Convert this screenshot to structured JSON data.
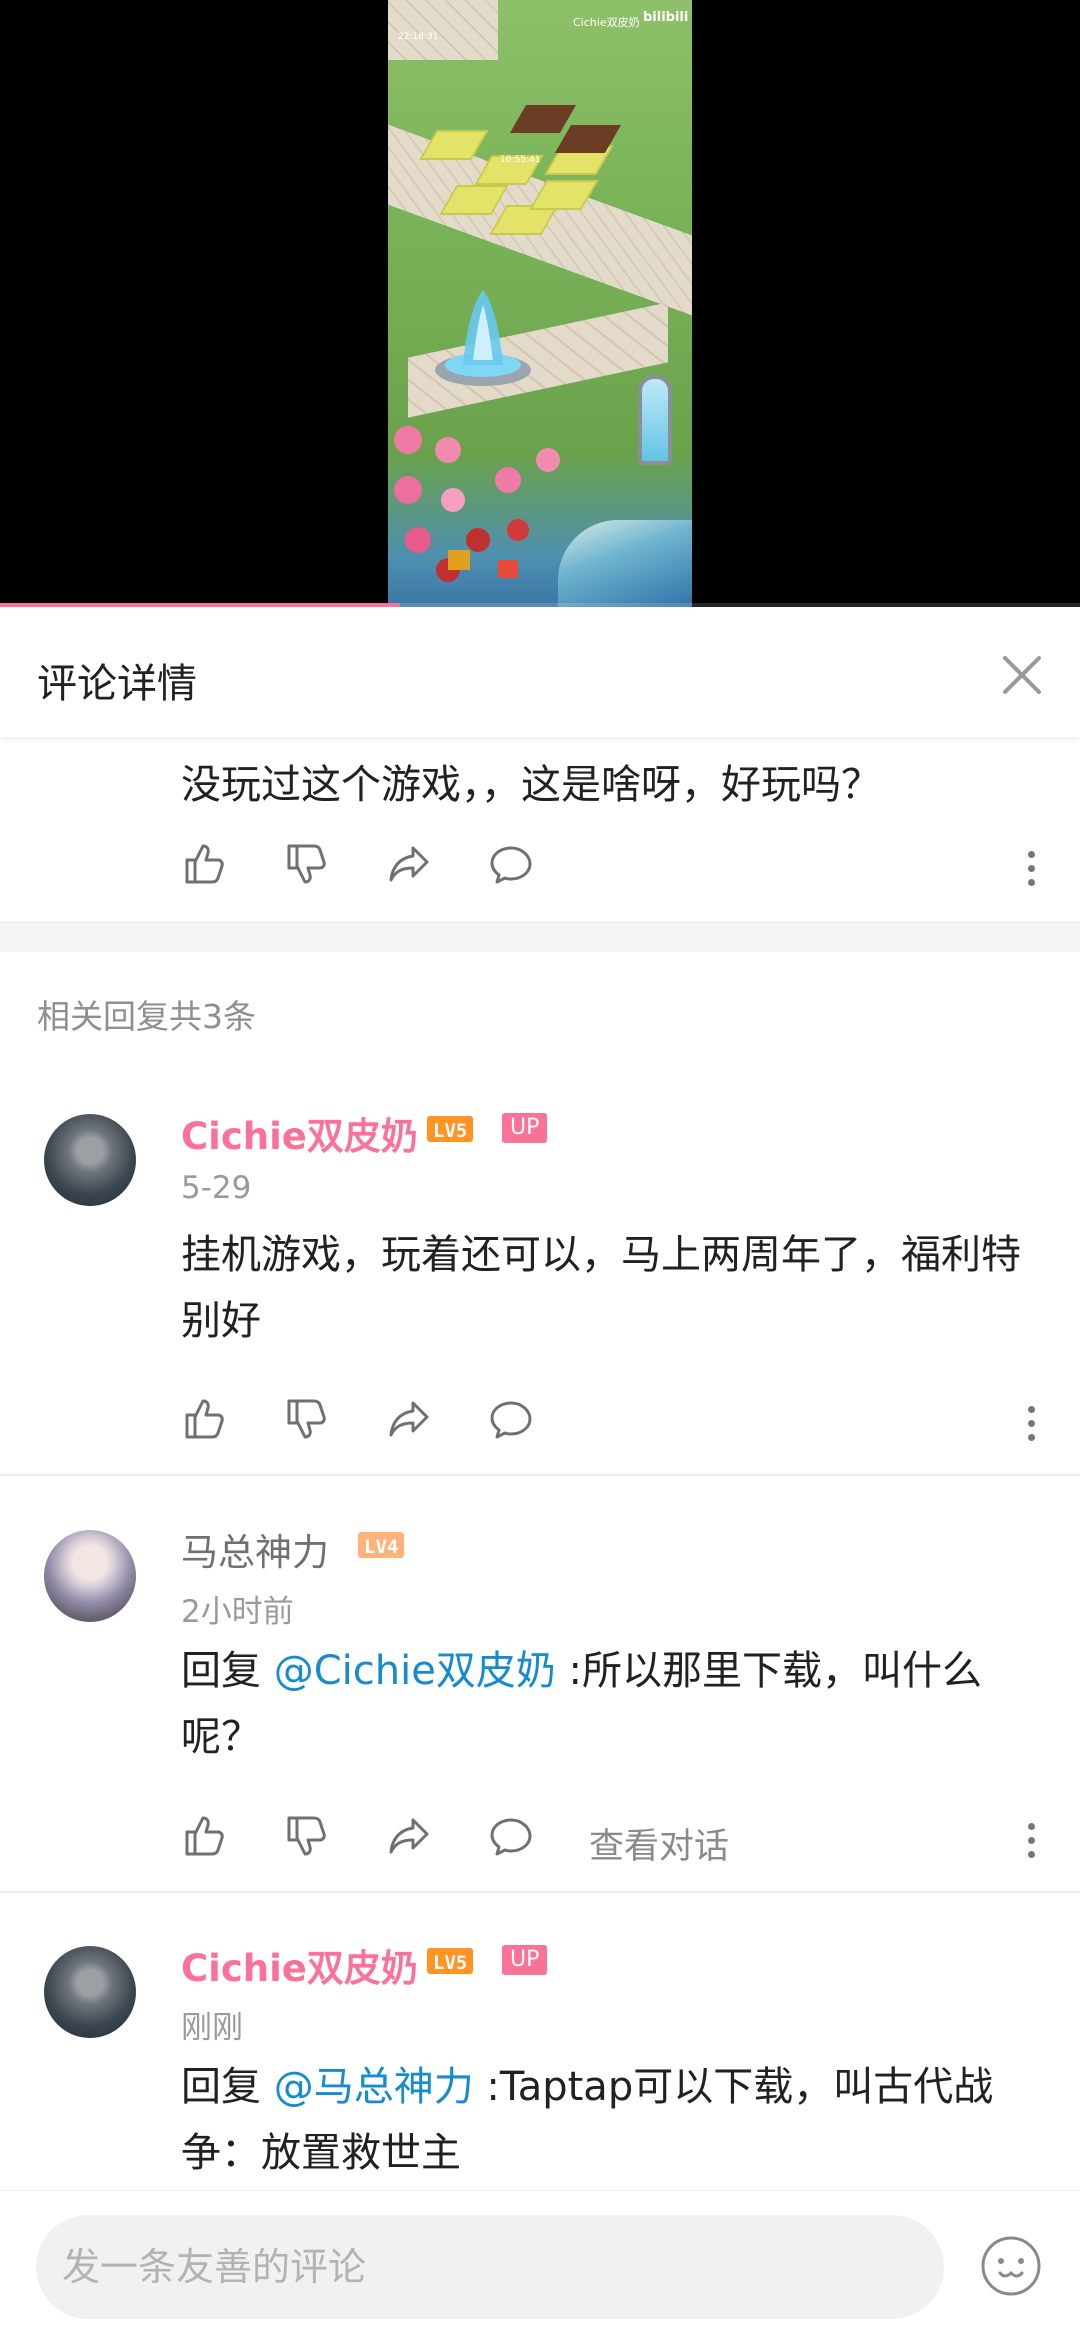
{
  "video": {
    "watermark_user": "Cichie双皮奶",
    "watermark_logo": "bilibili",
    "watermark_time": "22:18:31",
    "overlay_time": "10:55:41",
    "progress_fraction": 0.37
  },
  "panel": {
    "title": "评论详情"
  },
  "root_comment": {
    "text": "没玩过这个游戏，，这是啥呀，好玩吗？"
  },
  "reply_summary": "相关回复共3条",
  "replies": [
    {
      "user": "Cichie双皮奶",
      "level": "LV5",
      "badge": "UP",
      "time": "5-29",
      "prefix": "",
      "mention": "",
      "text": "挂机游戏，玩着还可以，马上两周年了，福利特别好"
    },
    {
      "user": "马总神力",
      "level": "LV4",
      "badge": "",
      "time": "2小时前",
      "prefix": "回复 ",
      "mention": "@Cichie双皮奶",
      "text": " :所以那里下载，叫什么呢？",
      "see_conversation": "查看对话"
    },
    {
      "user": "Cichie双皮奶",
      "level": "LV5",
      "badge": "UP",
      "time": "刚刚",
      "prefix": "回复 ",
      "mention": "@马总神力",
      "text": " :Taptap可以下载，叫古代战争：放置救世主"
    }
  ],
  "input": {
    "placeholder": "发一条友善的评论",
    "value": ""
  },
  "colors": {
    "accent_pink": "#fb7299",
    "mention_blue": "#178bcf",
    "level5": "#ff9425",
    "level4": "#ffb27a"
  },
  "icons": [
    "like-icon",
    "dislike-icon",
    "share-icon",
    "reply-icon",
    "more-icon",
    "close-icon",
    "emoji-icon"
  ]
}
